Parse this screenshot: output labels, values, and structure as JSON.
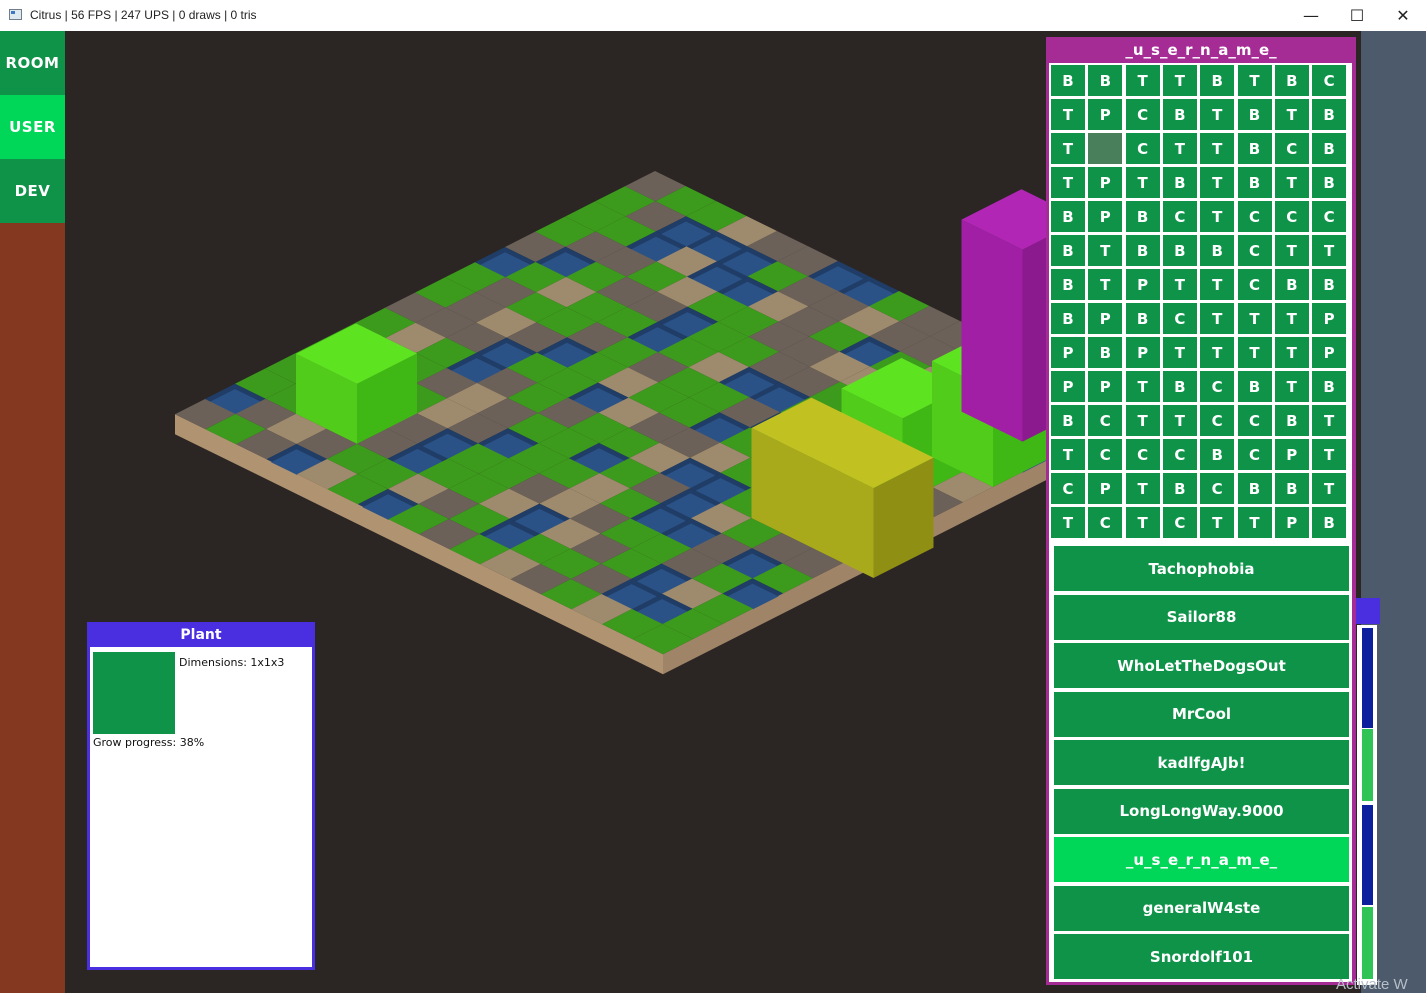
{
  "window": {
    "title": "Citrus | 56 FPS | 247 UPS | 0 draws | 0 tris",
    "minimize": "—",
    "maximize": "☐",
    "close": "✕"
  },
  "nav": {
    "room": "ROOM",
    "user": "USER",
    "dev": "DEV",
    "active": "USER",
    "colors": {
      "normal": "#0e9349",
      "active": "#00d758"
    }
  },
  "plant_panel": {
    "title": "Plant",
    "dimensions": "Dimensions: 1x1x3",
    "grow_progress_text": "Grow progress: 38%",
    "grow_progress": 0.38,
    "color": "#0e9349"
  },
  "user_panel": {
    "title": "_u_s_e_r_n_a_m_e_",
    "grid": [
      [
        "B",
        "B",
        "T",
        "T",
        "B",
        "T",
        "B",
        "C"
      ],
      [
        "T",
        "P",
        "C",
        "B",
        "T",
        "B",
        "T",
        "B"
      ],
      [
        "T",
        "",
        "C",
        "T",
        "T",
        "B",
        "C",
        "B"
      ],
      [
        "T",
        "P",
        "T",
        "B",
        "T",
        "B",
        "T",
        "B"
      ],
      [
        "B",
        "P",
        "B",
        "C",
        "T",
        "C",
        "C",
        "C"
      ],
      [
        "B",
        "T",
        "B",
        "B",
        "B",
        "C",
        "T",
        "T"
      ],
      [
        "B",
        "T",
        "P",
        "T",
        "T",
        "C",
        "B",
        "B"
      ],
      [
        "B",
        "P",
        "B",
        "C",
        "T",
        "T",
        "T",
        "P"
      ],
      [
        "P",
        "B",
        "P",
        "T",
        "T",
        "T",
        "T",
        "P"
      ],
      [
        "P",
        "P",
        "T",
        "B",
        "C",
        "B",
        "T",
        "B"
      ],
      [
        "B",
        "C",
        "T",
        "T",
        "C",
        "C",
        "B",
        "T"
      ],
      [
        "T",
        "C",
        "C",
        "C",
        "B",
        "C",
        "P",
        "T"
      ],
      [
        "C",
        "P",
        "T",
        "B",
        "C",
        "B",
        "B",
        "T"
      ],
      [
        "T",
        "C",
        "T",
        "C",
        "T",
        "T",
        "P",
        "B"
      ]
    ],
    "selected_cell": {
      "row": 2,
      "col": 1
    },
    "users": [
      "Tachophobia",
      "Sailor88",
      "WhoLetTheDogsOut",
      "MrCool",
      "kadlfgAJb!",
      "LongLongWay.9000",
      "_u_s_e_r_n_a_m_e_",
      "generalW4ste",
      "Snordolf101"
    ],
    "active_user": "_u_s_e_r_n_a_m_e_"
  },
  "watermark": "Activate W",
  "scene": {
    "tile_colors": {
      "G": "#3c9a1c",
      "D": "#6b6158",
      "S": "#9e8a6c",
      "W": "#2b5286",
      "X": "#6b6158"
    },
    "map": [
      "DGGSDDWWGDDGGSGS",
      "GDWWWGDDSDDGGWSS",
      "GGWSWWSDGWGSDDGD",
      "GDDGSGGDDSSWGSSW",
      "DWGDDWGGDDGGDDDG",
      "WGSGGWGSWWGGGSDS",
      "GDGGDGDGGDWSGDGD",
      "GDSDWGSGGWGGDDGW",
      "DDDWGGWSDDSGGGSG",
      "GSGWDGDGGSWWGSGS",
      "GGGDSDGGWGDWSGDD",
      "GDGGSDWGGSGWWDWG",
      "GGDSDWGGDSDGGDGW",
      "GGDGDWGGSWSDGWSG",
      "WDSDGGSDGWGGDWWG",
      "DGDWSGWGDGSDGSGG"
    ],
    "objects": [
      {
        "name": "plant-block-back",
        "col": 2,
        "row": 12,
        "h": 1,
        "kind": "plant"
      },
      {
        "name": "plant-block-front-1",
        "col": 13,
        "row": 5,
        "h": 1.4,
        "kind": "plant"
      },
      {
        "name": "plant-block-front-2",
        "col": 14,
        "row": 3,
        "h": 1.6,
        "kind": "plant"
      },
      {
        "name": "magenta-tower",
        "col": 13,
        "row": 1,
        "h": 3.2,
        "kind": "tower"
      },
      {
        "name": "yellow-block",
        "col": 13,
        "row": 8,
        "h": 1.5,
        "kind": "box"
      }
    ]
  }
}
